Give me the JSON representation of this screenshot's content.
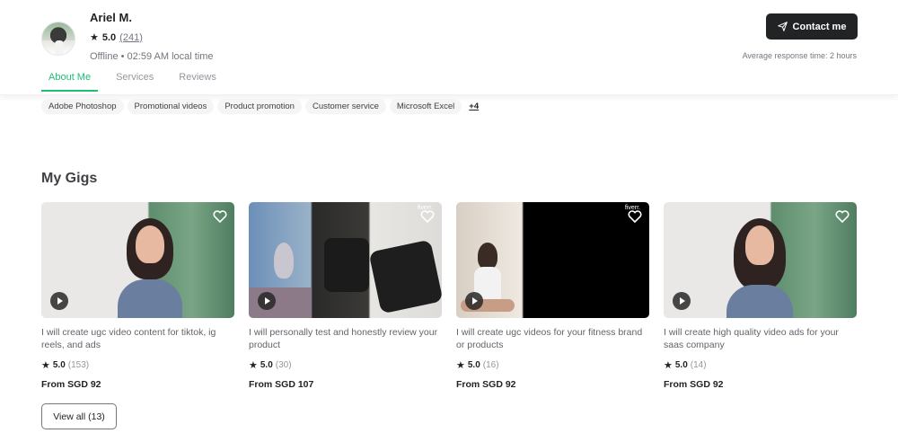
{
  "profile": {
    "name": "Ariel M.",
    "rating": "5.0",
    "rating_count": "(241)",
    "status": "Offline • 02:59 AM local time"
  },
  "tabs": [
    {
      "label": "About Me",
      "active": true
    },
    {
      "label": "Services",
      "active": false
    },
    {
      "label": "Reviews",
      "active": false
    }
  ],
  "contact": {
    "label": "Contact me",
    "response_time": "Average response time: 2 hours"
  },
  "skills": {
    "items": [
      "Adobe Photoshop",
      "Promotional videos",
      "Product promotion",
      "Customer service",
      "Microsoft Excel"
    ],
    "more": "+4"
  },
  "gigs_section": {
    "title": "My Gigs",
    "view_all": "View all (13)"
  },
  "gigs": [
    {
      "title": "I will create ugc video content for tiktok, ig reels, and ads",
      "rating": "5.0",
      "count": "(153)",
      "price": "From SGD 92"
    },
    {
      "title": "I will personally test and honestly review your product",
      "rating": "5.0",
      "count": "(30)",
      "price": "From SGD 107"
    },
    {
      "title": "I will create ugc videos for your fitness brand or products",
      "rating": "5.0",
      "count": "(16)",
      "price": "From SGD 92"
    },
    {
      "title": "I will create high quality video ads for your saas company",
      "rating": "5.0",
      "count": "(14)",
      "price": "From SGD 92"
    }
  ],
  "thumb_watermark": "fiverr.",
  "colors": {
    "accent": "#1dbf73",
    "primary_button": "#222325",
    "text": "#404145",
    "muted": "#74767e"
  },
  "icons": {
    "star": "star-icon",
    "heart": "heart-icon",
    "play": "play-icon",
    "send": "send-icon"
  }
}
